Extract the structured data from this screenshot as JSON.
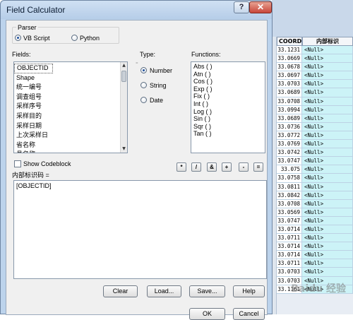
{
  "dialog": {
    "title": "Field Calculator",
    "help_glyph": "?",
    "close_glyph": "✕"
  },
  "parser": {
    "label": "Parser",
    "options": [
      {
        "label": "VB Script",
        "selected": true
      },
      {
        "label": "Python",
        "selected": false
      }
    ]
  },
  "fields": {
    "label": "Fields:",
    "items": [
      "OBJECTID",
      "Shape",
      "统一编号",
      "调查组号",
      "采样序号",
      "采样目的",
      "采样日期",
      "上次采样日",
      "省名称",
      "县名称"
    ]
  },
  "type": {
    "label": "Type:",
    "options": [
      {
        "label": "Number",
        "selected": true
      },
      {
        "label": "String",
        "selected": false
      },
      {
        "label": "Date",
        "selected": false
      }
    ]
  },
  "functions": {
    "label": "Functions:",
    "items": [
      "Abs ( )",
      "Atn ( )",
      "Cos ( )",
      "Exp ( )",
      "Fix ( )",
      "Int ( )",
      "Log ( )",
      "Sin ( )",
      "Sqr ( )",
      "Tan ( )"
    ]
  },
  "show_codeblock": {
    "label": "Show Codeblock",
    "checked": false
  },
  "operators": [
    "*",
    "/",
    "&",
    "+",
    "-",
    "="
  ],
  "expression": {
    "label": "内部标识码 =",
    "value": "[OBJECTID]"
  },
  "buttons": {
    "clear": "Clear",
    "load": "Load...",
    "save": "Save...",
    "help": "Help",
    "ok": "OK",
    "cancel": "Cancel"
  },
  "table": {
    "headers": [
      "COORD",
      "内部标识"
    ],
    "rows": [
      [
        "33.1231",
        "<Null>"
      ],
      [
        "33.0669",
        "<Null>"
      ],
      [
        "33.0678",
        "<Null>"
      ],
      [
        "33.0697",
        "<Null>"
      ],
      [
        "33.0703",
        "<Null>"
      ],
      [
        "33.0689",
        "<Null>"
      ],
      [
        "33.0708",
        "<Null>"
      ],
      [
        "33.0994",
        "<Null>"
      ],
      [
        "33.0689",
        "<Null>"
      ],
      [
        "33.0736",
        "<Null>"
      ],
      [
        "33.0772",
        "<Null>"
      ],
      [
        "33.0769",
        "<Null>"
      ],
      [
        "33.0742",
        "<Null>"
      ],
      [
        "33.0747",
        "<Null>"
      ],
      [
        "33.075",
        "<Null>"
      ],
      [
        "33.0758",
        "<Null>"
      ],
      [
        "33.0811",
        "<Null>"
      ],
      [
        "33.0842",
        "<Null>"
      ],
      [
        "33.0708",
        "<Null>"
      ],
      [
        "33.0569",
        "<Null>"
      ],
      [
        "33.0747",
        "<Null>"
      ],
      [
        "33.0714",
        "<Null>"
      ],
      [
        "33.0711",
        "<Null>"
      ],
      [
        "33.0714",
        "<Null>"
      ],
      [
        "33.0714",
        "<Null>"
      ],
      [
        "33.0711",
        "<Null>"
      ],
      [
        "33.0703",
        "<Null>"
      ],
      [
        "33.0703",
        "<Null>"
      ],
      [
        "33.1161",
        "<Null>"
      ]
    ]
  },
  "watermark": "Baidu 经验"
}
